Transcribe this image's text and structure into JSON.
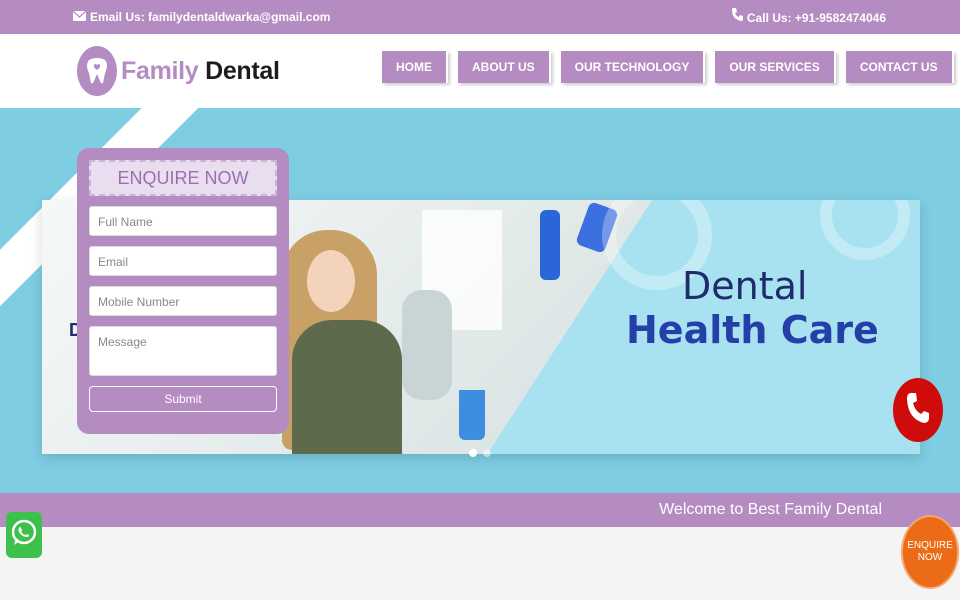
{
  "topbar": {
    "email_text": "Email Us: familydentaldwarka@gmail.com",
    "phone_text": "Call Us: +91-9582474046"
  },
  "brand": {
    "word1": "Family",
    "word2": "Dental",
    "color": "#b48cc2"
  },
  "nav": {
    "items": [
      {
        "label": "HOME"
      },
      {
        "label": "ABOUT US"
      },
      {
        "label": "OUR TECHNOLOGY"
      },
      {
        "label": "OUR SERVICES"
      },
      {
        "label": "CONTACT US"
      }
    ]
  },
  "banner": {
    "line1": "Dental",
    "line2": "Health Care",
    "partial": "D",
    "slide_count": 2,
    "active_slide": 1
  },
  "enquiry": {
    "title": "ENQUIRE NOW",
    "full_name_placeholder": "Full Name",
    "email_placeholder": "Email",
    "mobile_placeholder": "Mobile Number",
    "message_placeholder": "Message",
    "submit_label": "Submit"
  },
  "welcome": {
    "text": "Welcome to Best Family Dental"
  },
  "floating": {
    "enquire_line1": "ENQUIRE",
    "enquire_line2": "NOW",
    "whatsapp_icon": "whatsapp-icon",
    "call_icon": "phone-icon"
  },
  "colors": {
    "purple": "#b48cc2",
    "hero_blue": "#7ecde3",
    "call_red": "#d00b0b",
    "orange": "#ec6b16",
    "whatsapp_green": "#3ec04c"
  }
}
